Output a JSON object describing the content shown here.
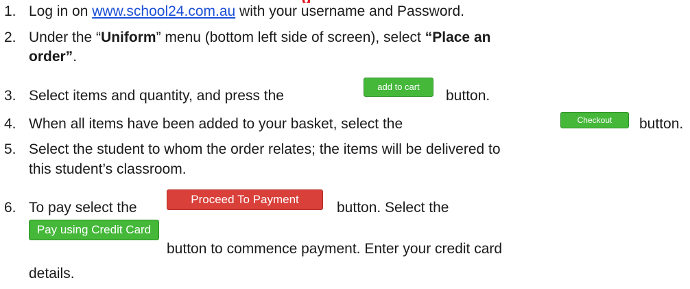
{
  "heading_fragment": "g",
  "steps": [
    {
      "num": "1.",
      "pre": "Log in on ",
      "link": "www.school24.com.au",
      "post": " with your username and Password."
    },
    {
      "num": "2.",
      "pre": "Under the “",
      "bold1": "Uniform",
      "mid": "” menu (bottom left side of screen), select ",
      "bold2a": "“Place an",
      "bold2b": "order”",
      "end": "."
    },
    {
      "num": "3.",
      "pre": "Select items and quantity, and press the",
      "post": "button."
    },
    {
      "num": "4.",
      "pre": "When all items have been added to your basket, select the",
      "post": "button."
    },
    {
      "num": "5.",
      "line1": "Select the student to whom the order relates; the items will be delivered to",
      "line2": "this student’s classroom."
    },
    {
      "num": "6.",
      "pre": "To pay select the",
      "mid": "button.  Select the",
      "post": "button to commence payment. Enter your credit card",
      "line3": "details."
    }
  ],
  "buttons": {
    "add_to_cart": "add to cart",
    "checkout": "Checkout",
    "proceed_to_payment": "Proceed To Payment",
    "pay_using_credit_card": "Pay using Credit Card"
  }
}
